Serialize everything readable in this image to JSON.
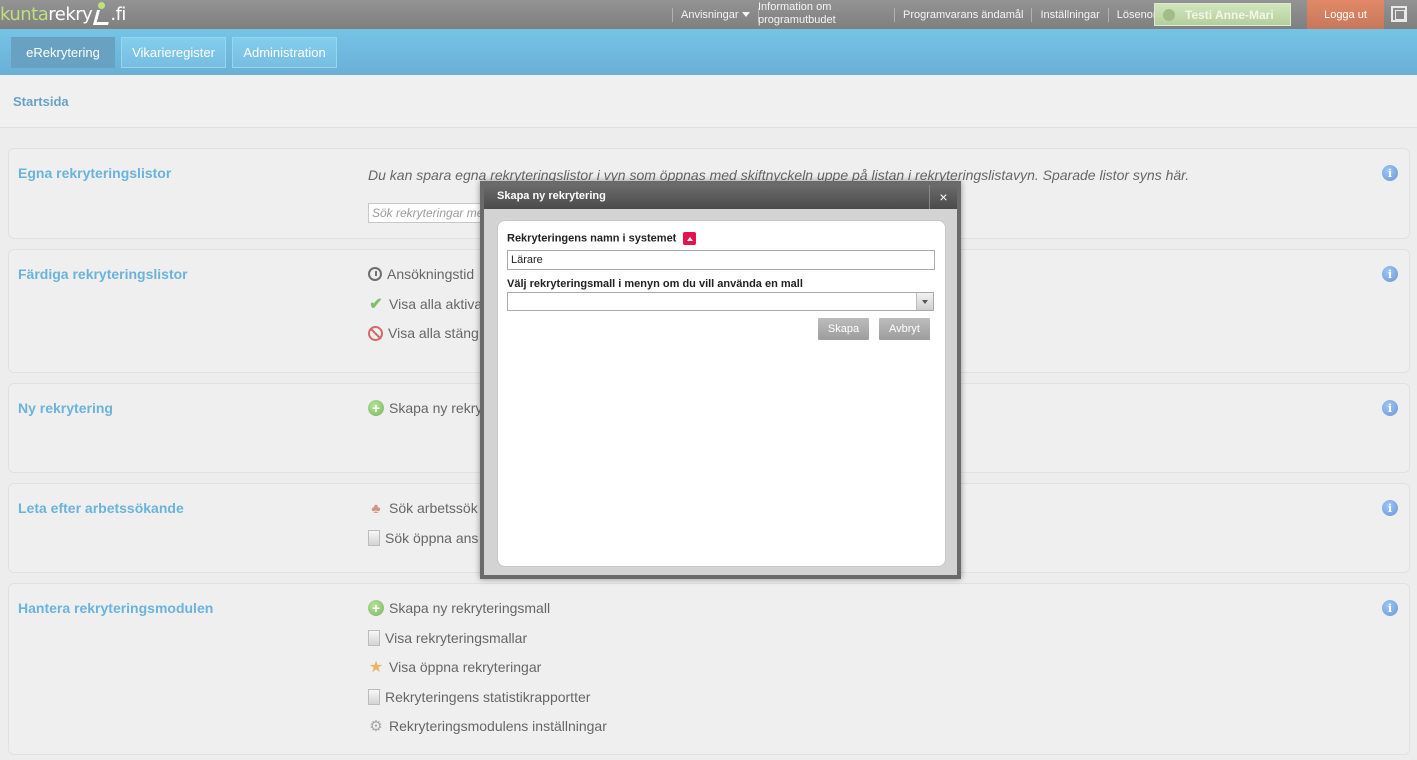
{
  "header": {
    "logo_part1": "kunta",
    "logo_part2": "rekry",
    "logo_part3": ".fi",
    "anvisningar": "Anvisningar",
    "info_line1": "Information om",
    "info_line2": "programutbudet",
    "links": [
      "Programvarans ändamål",
      "Inställningar",
      "Lösenord"
    ],
    "user": "Testi Anne-Mari",
    "logout": "Logga ut"
  },
  "tabs": [
    "eRekrytering",
    "Vikarieregister",
    "Administration"
  ],
  "breadcrumb": "Startsida",
  "panels": {
    "egna": {
      "title": "Egna rekryteringslistor",
      "description": "Du kan spara egna rekryteringslistor i vyn som öppnas med skiftnyckeln uppe på listan i rekryteringslistavyn. Sparade listor syns här.",
      "search_placeholder": "Sök rekryteringar me"
    },
    "fardiga": {
      "title": "Färdiga rekryteringslistor",
      "items": [
        "Ansökningstid",
        "Visa alla aktiva",
        "Visa alla stäng"
      ]
    },
    "ny": {
      "title": "Ny rekrytering",
      "items": [
        "Skapa ny rekry"
      ]
    },
    "leta": {
      "title": "Leta efter arbetssökande",
      "items": [
        "Sök arbetssök",
        "Sök öppna ans"
      ]
    },
    "hantera": {
      "title": "Hantera rekryteringsmodulen",
      "items": [
        "Skapa ny rekryteringsmall",
        "Visa rekryteringsmallar",
        "Visa öppna rekryteringar",
        "Rekryteringens statistikrapportter",
        "Rekryteringsmodulens inställningar"
      ]
    }
  },
  "modal": {
    "title": "Skapa ny rekrytering",
    "close": "×",
    "name_label": "Rekryteringens namn i systemet",
    "name_value": "Lärare",
    "template_label": "Välj rekryteringsmall i menyn om du vill använda en mall",
    "template_value": "",
    "create": "Skapa",
    "cancel": "Avbryt"
  },
  "colors": {
    "accent": "#1a8bc9",
    "tabbar": "#2ba4d9",
    "logout": "#c03c0c",
    "user": "#a3c983"
  }
}
